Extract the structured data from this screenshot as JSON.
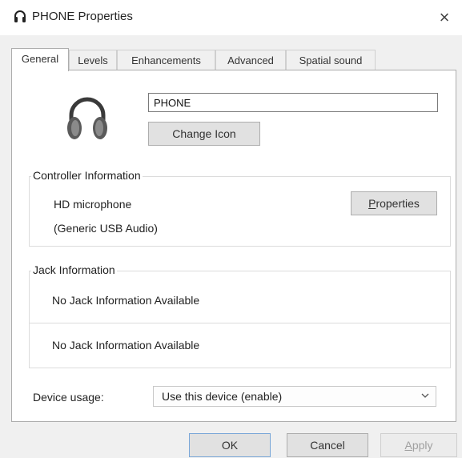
{
  "window": {
    "title": "PHONE Properties",
    "close_label": "×",
    "icon": "headset-icon"
  },
  "tabs": [
    {
      "label": "General",
      "active": true
    },
    {
      "label": "Levels",
      "active": false
    },
    {
      "label": "Enhancements",
      "active": false
    },
    {
      "label": "Advanced",
      "active": false
    },
    {
      "label": "Spatial sound",
      "active": false
    }
  ],
  "general": {
    "device_icon": "headphones-icon",
    "device_name_value": "PHONE",
    "change_icon_label": "Change Icon",
    "controller": {
      "legend": "Controller Information",
      "name": "HD  microphone",
      "driver": "(Generic USB Audio)",
      "properties_label": "Properties",
      "properties_access_key": "P"
    },
    "jack": {
      "legend": "Jack Information",
      "rows": [
        "No Jack Information Available",
        "No Jack Information Available"
      ]
    },
    "device_usage": {
      "label": "Device usage:",
      "selected": "Use this device (enable)"
    }
  },
  "footer": {
    "ok_label": "OK",
    "cancel_label": "Cancel",
    "apply_label": "Apply",
    "apply_enabled": false
  }
}
